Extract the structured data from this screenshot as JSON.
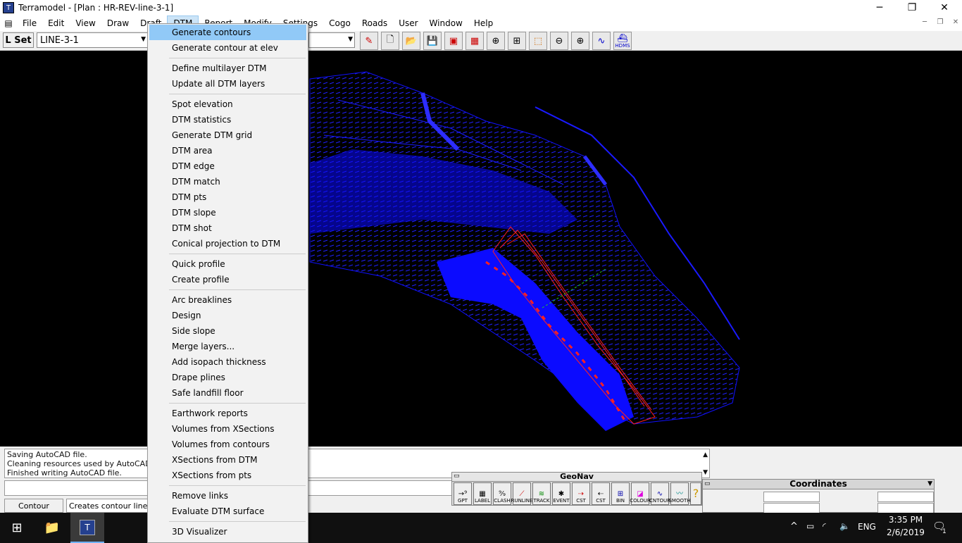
{
  "window": {
    "title": "Terramodel - [Plan : HR-REV-line-3-1]",
    "minimize": "─",
    "restore": "❐",
    "close": "✕"
  },
  "menubar": [
    "File",
    "Edit",
    "View",
    "Draw",
    "Draft",
    "DTM",
    "Report",
    "Modify",
    "Settings",
    "Cogo",
    "Roads",
    "User",
    "Window",
    "Help"
  ],
  "toolbar": {
    "lset_label": "L Set",
    "layer_value": "LINE-3-1",
    "hdms_label": "HDMS"
  },
  "dtm_menu": {
    "groups": [
      [
        "Generate contours",
        "Generate contour at elev"
      ],
      [
        "Define multilayer DTM",
        "Update all DTM layers"
      ],
      [
        "Spot elevation",
        "DTM statistics",
        "Generate DTM grid",
        "DTM area",
        "DTM edge",
        "DTM match",
        "DTM pts",
        "DTM slope",
        "DTM shot",
        "Conical projection to DTM"
      ],
      [
        "Quick profile",
        "Create profile"
      ],
      [
        "Arc breaklines",
        "Design",
        "Side slope",
        "Merge layers...",
        "Add isopach thickness",
        "Drape plines",
        "Safe landfill floor"
      ],
      [
        "Earthwork reports",
        "Volumes from XSections",
        "Volumes from contours",
        "XSections from DTM",
        "XSections from pts"
      ],
      [
        "Remove links",
        "Evaluate DTM surface"
      ],
      [
        "3D Visualizer"
      ]
    ],
    "highlighted": "Generate contours"
  },
  "log": {
    "lines": [
      "Saving AutoCAD file.",
      "Cleaning resources used by AutoCAD trans",
      "Finished writing AutoCAD file."
    ]
  },
  "status": {
    "command": "Contour",
    "description": "Creates contour lines fro"
  },
  "geonav": {
    "title": "GeoNav",
    "buttons": [
      "GPT",
      "LABEL",
      "CLASH",
      "RUNLINE",
      "TRACK",
      "EVENT",
      "CST",
      "CST",
      "BIN",
      "COLOUR",
      "CNTOUR",
      "SMOOTH"
    ],
    "help": "?"
  },
  "coordinates": {
    "title": "Coordinates"
  },
  "taskbar": {
    "lang": "ENG",
    "time": "3:35 PM",
    "date": "2/6/2019",
    "notif_count": "1"
  },
  "colors": {
    "canvas": "#000000",
    "dtm": "#1010ff",
    "profile": "#ff2020",
    "menu_highlight": "#91c9f7"
  }
}
